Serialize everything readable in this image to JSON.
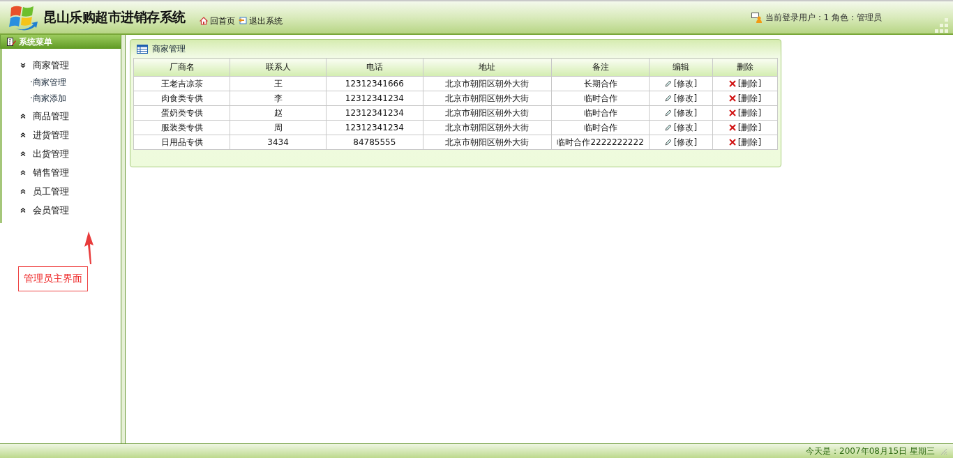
{
  "header": {
    "title": "昆山乐购超市进销存系统",
    "links": [
      {
        "kind": "home",
        "label": "回首页"
      },
      {
        "kind": "exit",
        "label": "退出系统"
      }
    ],
    "user_info": "当前登录用户：1 角色：管理员"
  },
  "sidebar": {
    "title": "系统菜单",
    "groups": [
      {
        "label": "商家管理",
        "expanded": true,
        "children": [
          {
            "label": "·商家管理"
          },
          {
            "label": "·商家添加"
          }
        ]
      },
      {
        "label": "商品管理",
        "expanded": false
      },
      {
        "label": "进货管理",
        "expanded": false
      },
      {
        "label": "出货管理",
        "expanded": false
      },
      {
        "label": "销售管理",
        "expanded": false
      },
      {
        "label": "员工管理",
        "expanded": false
      },
      {
        "label": "会员管理",
        "expanded": false
      }
    ]
  },
  "annotation": {
    "text": "管理员主界面"
  },
  "panel": {
    "title": "商家管理",
    "table": {
      "columns": [
        "厂商名",
        "联系人",
        "电话",
        "地址",
        "备注",
        "编辑",
        "删除"
      ],
      "rows": [
        {
          "cells": [
            "王老吉凉茶",
            "王",
            "12312341666",
            "北京市朝阳区朝外大街",
            "长期合作"
          ],
          "edit": "[修改]",
          "delete": "[删除]"
        },
        {
          "cells": [
            "肉食类专供",
            "李",
            "12312341234",
            "北京市朝阳区朝外大街",
            "临时合作"
          ],
          "edit": "[修改]",
          "delete": "[删除]"
        },
        {
          "cells": [
            "蛋奶类专供",
            "赵",
            "12312341234",
            "北京市朝阳区朝外大街",
            "临时合作"
          ],
          "edit": "[修改]",
          "delete": "[删除]"
        },
        {
          "cells": [
            "服装类专供",
            "周",
            "12312341234",
            "北京市朝阳区朝外大街",
            "临时合作"
          ],
          "edit": "[修改]",
          "delete": "[删除]"
        },
        {
          "cells": [
            "日用品专供",
            "3434",
            "84785555",
            "北京市朝阳区朝外大街",
            "临时合作2222222222"
          ],
          "edit": "[修改]",
          "delete": "[删除]"
        }
      ]
    }
  },
  "status_bar": {
    "date": "今天是：2007年08月15日 星期三"
  }
}
